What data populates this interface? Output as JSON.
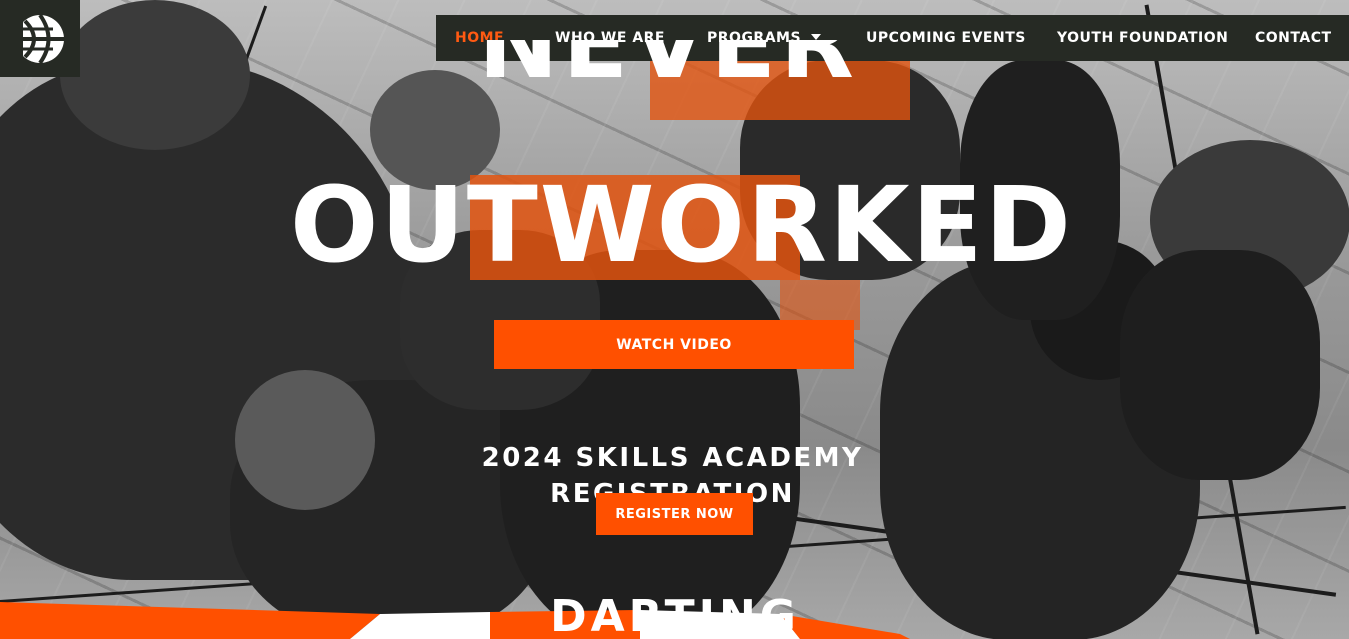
{
  "nav": {
    "items": [
      {
        "label": "HOME",
        "active": true
      },
      {
        "label": "WHO WE ARE",
        "active": false
      },
      {
        "label": "PROGRAMS",
        "active": false,
        "has_dropdown": true
      },
      {
        "label": "UPCOMING EVENTS",
        "active": false
      },
      {
        "label": "YOUTH FOUNDATION",
        "active": false
      },
      {
        "label": "CONTACT",
        "active": false
      }
    ]
  },
  "hero": {
    "headline_top": "NEVER",
    "headline_main": "OUTWORKED",
    "watch_button": "WATCH VIDEO",
    "registration_heading": "2024 SKILLS ACADEMY REGISTRATION",
    "register_button": "REGISTER NOW",
    "next_section_heading": "DARTING"
  },
  "colors": {
    "accent": "#ff5000",
    "nav_bg": "#262a24",
    "active_nav": "#ff5a12",
    "text": "#ffffff"
  },
  "icons": {
    "logo": "basketball-logo-icon",
    "dropdown": "caret-down-icon"
  }
}
